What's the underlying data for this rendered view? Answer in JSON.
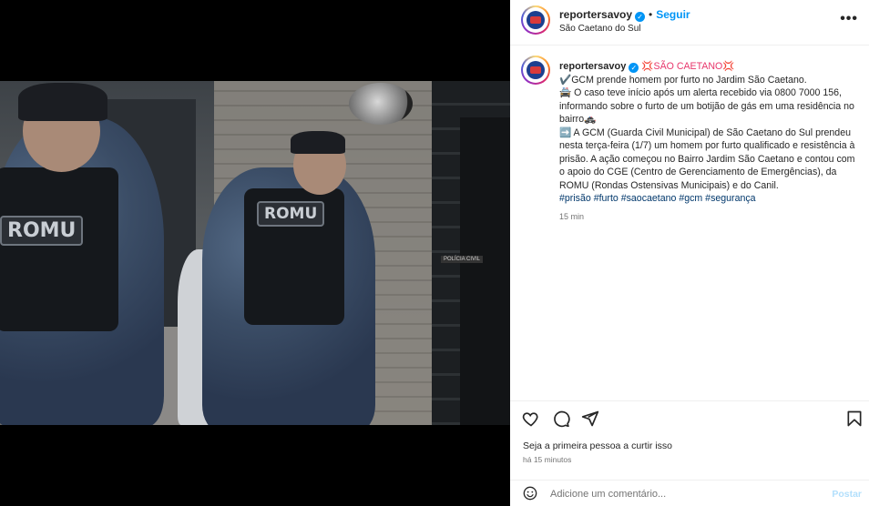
{
  "post": {
    "username": "reportersavoy",
    "follow_label": "Seguir",
    "location": "São Caetano do Sul",
    "dot": "•",
    "more_label": "•••",
    "verified_mark": "✓"
  },
  "caption": {
    "username": "reportersavoy",
    "headline": "💢SÃO CAETANO💢",
    "line1": "✔️GCM prende homem por furto no Jardim São Caetano.",
    "line2": "🚔 O caso teve início após um alerta recebido via 0800 7000 156, informando sobre o furto de um botijão de gás em uma residência no bairro🚓",
    "line3": "➡️ A GCM (Guarda Civil Municipal) de São Caetano do Sul prendeu nesta terça-feira (1/7) um homem por furto qualificado e resistência à prisão. A ação começou no Bairro Jardim São Caetano e contou com o apoio do CGE (Centro de Gerenciamento de Emergências), da ROMU (Rondas Ostensivas Municipais) e do Canil.",
    "hashtags": "#prisão #furto #saocaetano #gcm #segurança",
    "time": "15 min"
  },
  "photo": {
    "patch_left": "ROMU",
    "patch_right": "ROMU",
    "sign": "POLÍCIA CIVIL"
  },
  "actions": {
    "icons": [
      "heart-icon",
      "comment-icon",
      "share-icon",
      "bookmark-icon"
    ]
  },
  "likes": {
    "text": "Seja a primeira pessoa a curtir isso",
    "ago": "há 15 minutos"
  },
  "comment": {
    "placeholder": "Adicione um comentário...",
    "post_label": "Postar"
  },
  "colors": {
    "accent": "#0095f6",
    "hashtag": "#00376b",
    "muted": "#737373"
  }
}
